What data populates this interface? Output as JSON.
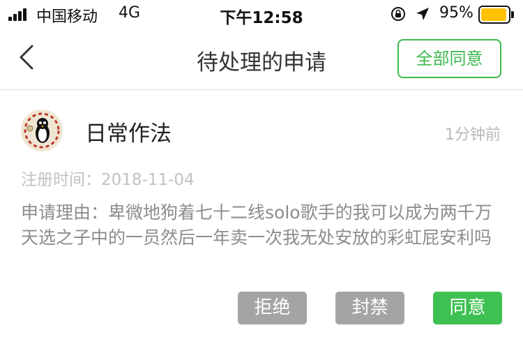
{
  "status_bar": {
    "carrier": "中国移动",
    "network": "4G",
    "time": "下午12:58",
    "battery_percent": "95%",
    "battery_level": 0.95,
    "battery_color": "#ffc200",
    "icons": [
      "signal-icon",
      "rotation-lock-icon",
      "location-arrow-icon",
      "battery-icon"
    ]
  },
  "nav": {
    "title": "待处理的申请",
    "approve_all_label": "全部同意",
    "accent": "#3cb84c"
  },
  "request": {
    "username": "日常作法",
    "time_ago": "1分钟前",
    "registration": "注册时间：2018-11-04",
    "reason": "申请理由：卑微地狗着七十二线solo歌手的我可以成为两千万天选之子中的一员然后一年卖一次我无处安放的彩虹屁安利吗",
    "actions": {
      "reject": "拒绝",
      "ban": "封禁",
      "agree": "同意"
    }
  }
}
